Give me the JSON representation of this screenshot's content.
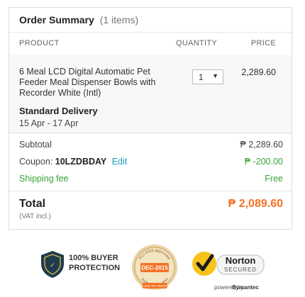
{
  "summary": {
    "title": "Order Summary",
    "count": "(1 items)",
    "columns": {
      "product": "PRODUCT",
      "quantity": "QUANTITY",
      "price": "PRICE"
    }
  },
  "item": {
    "name": "6 Meal LCD Digital Automatic Pet Feeder Meal Dispenser Bowls with Recorder White (Intl)",
    "quantity": "1",
    "price": "2,289.60",
    "delivery_title": "Standard Delivery",
    "delivery_dates": "15 Apr - 17 Apr"
  },
  "totals": {
    "subtotal_label": "Subtotal",
    "subtotal_value": "₱ 2,289.60",
    "coupon_label": "Coupon:",
    "coupon_code": "10LZDBDAY",
    "coupon_edit": "Edit",
    "coupon_value": "₱ -200.00",
    "shipping_label": "Shipping fee",
    "shipping_value": "Free",
    "total_label": "Total",
    "vat_note": "(VAT incl.)",
    "total_value": "₱ 2,089.60"
  },
  "trust_badges": {
    "buyer_line1": "100% BUYER",
    "buyer_line2": "PROTECTION",
    "pci_top": "PCI DSS approved",
    "pci_date": "DEC-2015",
    "pci_bottom": "more security - less",
    "pci_click": "CLICK TO VERIFY",
    "norton_name": "Norton",
    "norton_secured": "SECURED",
    "norton_powered": "powered by",
    "norton_brand": "Symantec"
  },
  "colors": {
    "accent_orange": "#f57224",
    "discount_green": "#3aa23a",
    "link_blue": "#1a9cb7",
    "norton_yellow": "#f7c31a"
  },
  "icons": {
    "buyer_protection": "shield-icon",
    "pci": "seal-icon",
    "norton": "checkmark-icon"
  }
}
